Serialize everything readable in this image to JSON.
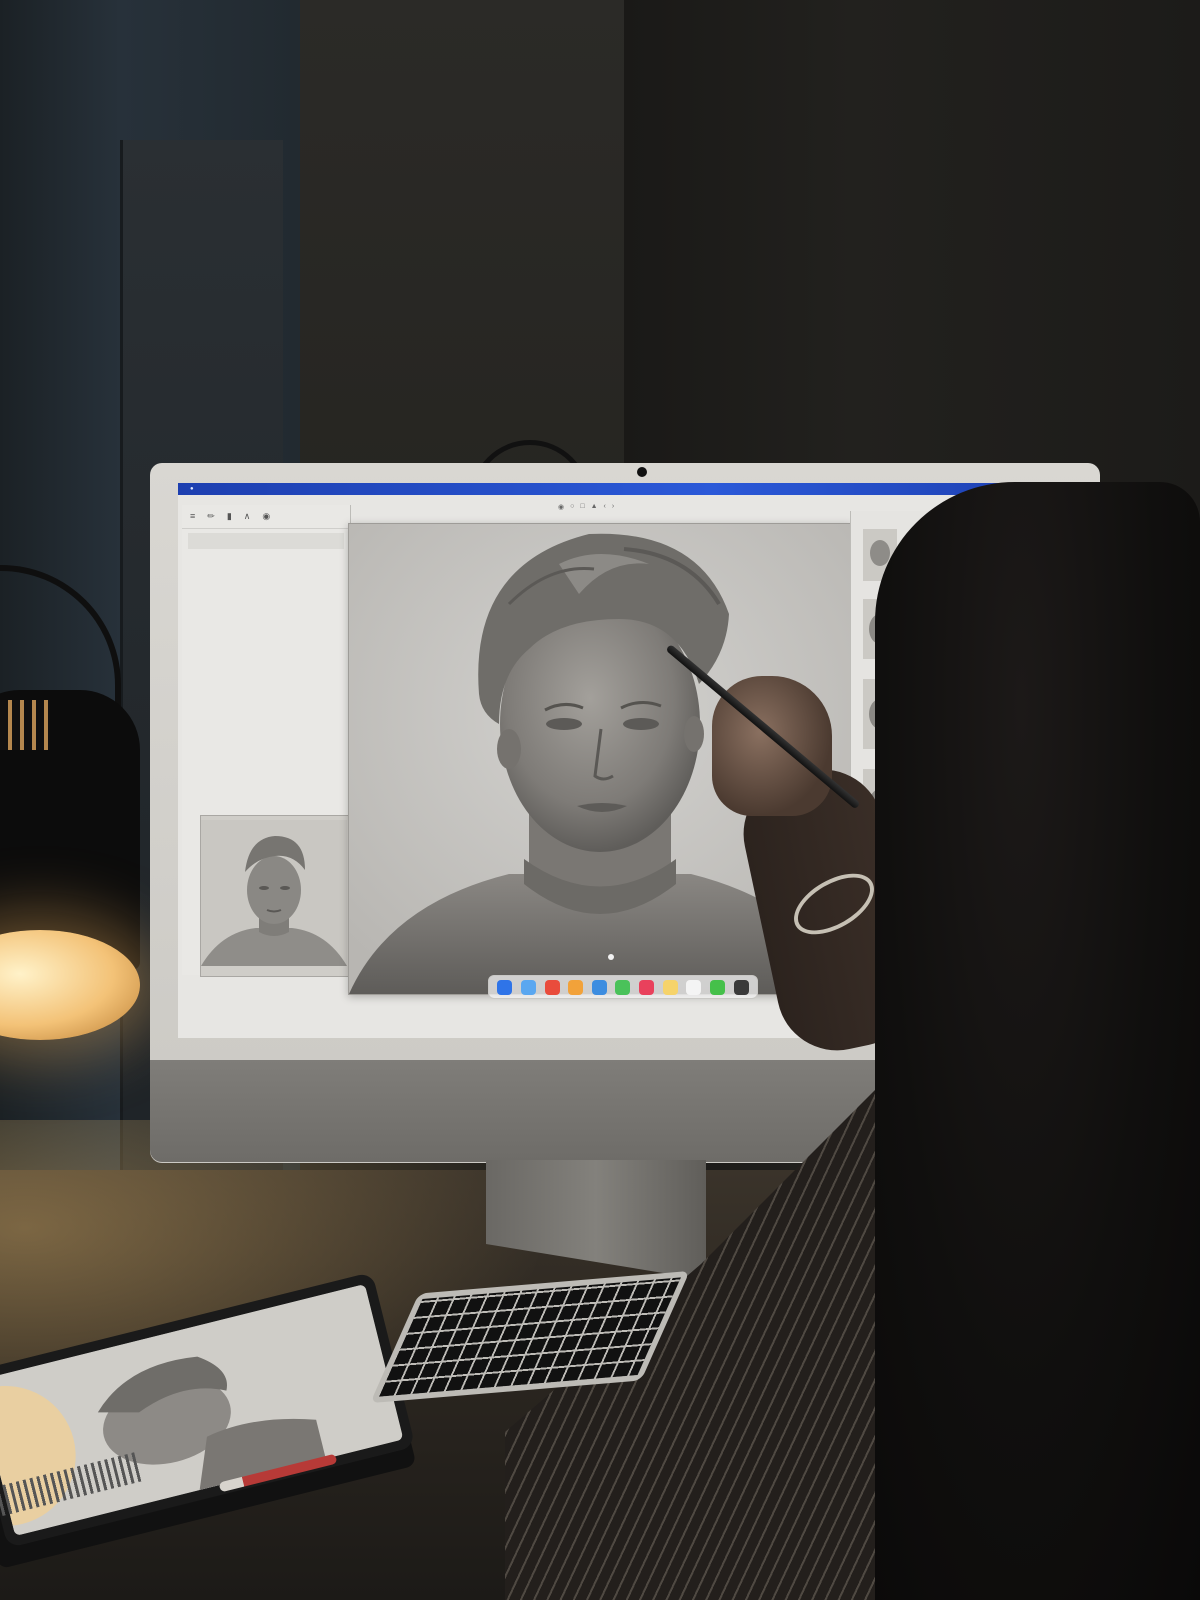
{
  "scene": {
    "room": "Dark studio at night",
    "colors": {
      "lamp_glow": "#f3c277",
      "menubar": "#2b59d8",
      "screen_bg": "#e7e6e3",
      "desk": "#2b2620"
    }
  },
  "screen": {
    "menubar": {
      "items": [
        "",
        "",
        "",
        "",
        "",
        ""
      ]
    },
    "left_panel": {
      "toolbar_icons": [
        "menu-icon",
        "pen-icon",
        "histogram-icon",
        "compass-icon",
        "pin-icon"
      ],
      "section_title": "",
      "rows": [
        "",
        "",
        "",
        "",
        "",
        "",
        "",
        "",
        "",
        "",
        "",
        "",
        "",
        "",
        "",
        ""
      ],
      "thumb_label": ""
    },
    "canvas": {
      "title": "",
      "toolbar_icons": [
        "tool-icon",
        "tool-icon",
        "tool-icon",
        "tool-icon",
        "tool-icon",
        "tool-icon"
      ]
    },
    "right_panel": {
      "label": ""
    },
    "dock": {
      "apps": [
        {
          "name": "app-store-icon",
          "color": "#2f74e8"
        },
        {
          "name": "finder-icon",
          "color": "#5aa7f0"
        },
        {
          "name": "photos-icon",
          "color": "#e94c3c"
        },
        {
          "name": "maps-icon",
          "color": "#f2a23a"
        },
        {
          "name": "safari-icon",
          "color": "#3d8de0"
        },
        {
          "name": "messages-icon",
          "color": "#4ac25a"
        },
        {
          "name": "music-icon",
          "color": "#e9415c"
        },
        {
          "name": "notes-icon",
          "color": "#f6d36a"
        },
        {
          "name": "calendar-icon",
          "color": "#f4f4f4"
        },
        {
          "name": "facetime-icon",
          "color": "#45c04a"
        },
        {
          "name": "settings-icon",
          "color": "#3a3a3a"
        }
      ]
    }
  }
}
